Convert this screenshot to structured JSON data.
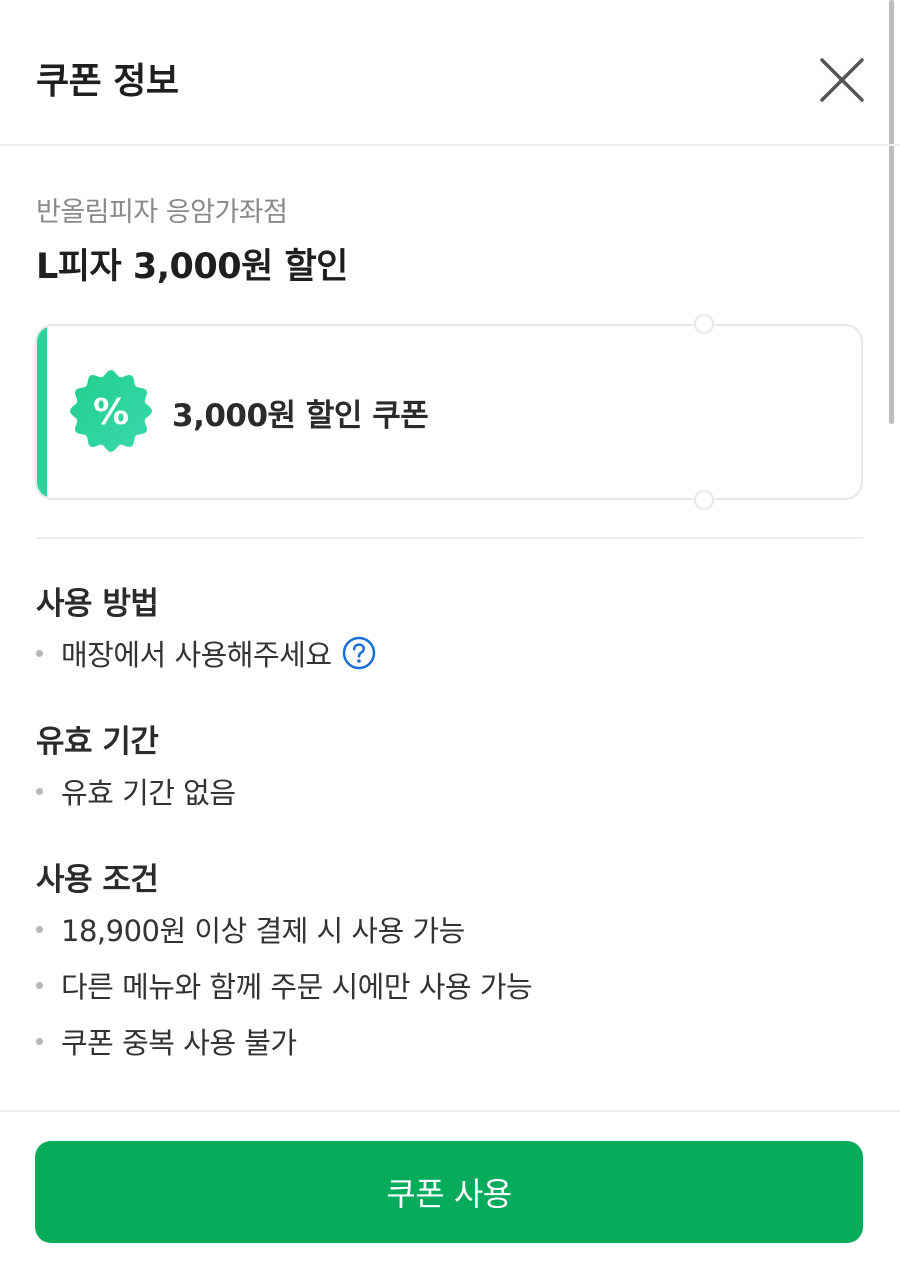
{
  "header": {
    "title": "쿠폰 정보",
    "close_icon": "close-icon"
  },
  "coupon": {
    "store": "반올림피자 응암가좌점",
    "title": "L피자 3,000원 할인",
    "ticket_label": "3,000원 할인 쿠폰",
    "badge_icon": "percent-badge-icon",
    "badge_symbol": "%"
  },
  "sections": {
    "usage": {
      "title": "사용 방법",
      "items": [
        "매장에서 사용해주세요"
      ],
      "help_icon": "question-circle-icon"
    },
    "validity": {
      "title": "유효 기간",
      "items": [
        "유효 기간 없음"
      ]
    },
    "conditions": {
      "title": "사용 조건",
      "items": [
        "18,900원 이상 결제 시 사용 가능",
        "다른 메뉴와 함께 주문 시에만 사용 가능",
        "쿠폰 중복 사용 불가"
      ]
    }
  },
  "actions": {
    "use_label": "쿠폰 사용"
  },
  "colors": {
    "accent_green": "#06ac5c",
    "ticket_accent": "#2ed19a",
    "help_blue": "#1a6fd8"
  }
}
